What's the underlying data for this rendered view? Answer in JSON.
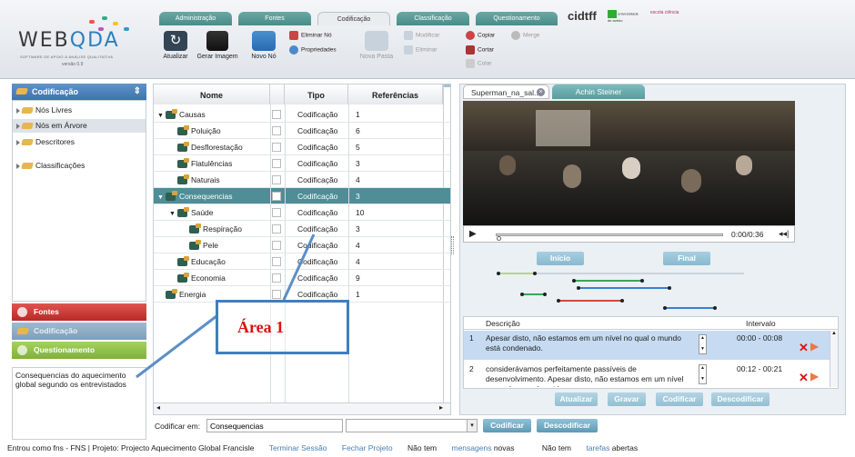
{
  "logo": {
    "wordmark_left": "WEB",
    "wordmark_right": "DA",
    "subtitle": "SOFTWARE DE APOIO À ANÁLISE QUALITATIVA",
    "version": "versão 0.9"
  },
  "top_tabs": [
    "Administração",
    "Fontes",
    "Codificação",
    "Classificação",
    "Questionamento"
  ],
  "partners": {
    "cidtff": "cidtff",
    "univ": "universidade de aveiro",
    "third": "escola ciência"
  },
  "toolbar": {
    "atualizar": "Atualizar",
    "gerar_imagem": "Gerar Imagem",
    "novo_no": "Novo Nó",
    "eliminar_no": "Eliminar Nó",
    "propriedades": "Propriedades",
    "modificar": "Modificar",
    "eliminar": "Eliminar",
    "nova_pasta": "Nova Pasta",
    "copiar": "Copiar",
    "merge": "Merge",
    "cortar": "Cortar",
    "colar": "Colar"
  },
  "left": {
    "header": "Codificação",
    "tree": [
      "Nós Livres",
      "Nós em Árvore",
      "Descritores",
      "Classificações"
    ],
    "accordions": [
      "Fontes",
      "Codificação",
      "Questionamento"
    ],
    "description": "Consequencias do aquecimento global segundo os entrevistados"
  },
  "table": {
    "headers": [
      "Nome",
      "Tipo",
      "Referências"
    ],
    "rows": [
      {
        "name": "Causas",
        "type": "Codificação",
        "refs": "1"
      },
      {
        "name": "Poluição",
        "type": "Codificação",
        "refs": "6"
      },
      {
        "name": "Desflorestação",
        "type": "Codificação",
        "refs": "5"
      },
      {
        "name": "Flatulências",
        "type": "Codificação",
        "refs": "3"
      },
      {
        "name": "Naturais",
        "type": "Codificação",
        "refs": "4"
      },
      {
        "name": "Consequencias",
        "type": "Codificação",
        "refs": "3"
      },
      {
        "name": "Saúde",
        "type": "Codificação",
        "refs": "10"
      },
      {
        "name": "Respiração",
        "type": "Codificação",
        "refs": "3"
      },
      {
        "name": "Pele",
        "type": "Codificação",
        "refs": "4"
      },
      {
        "name": "Educação",
        "type": "Codificação",
        "refs": "4"
      },
      {
        "name": "Economia",
        "type": "Codificação",
        "refs": "9"
      },
      {
        "name": "Energia",
        "type": "Codificação",
        "refs": "1"
      }
    ]
  },
  "annotation": {
    "label": "Área 1"
  },
  "coding": {
    "label": "Codificar em:",
    "value": "Consequencias",
    "codificar": "Codificar",
    "descodificar": "Descodificar"
  },
  "right": {
    "tab1": "Superman_na_sal...",
    "tab2": "Achin Steiner",
    "time": "0:00/0:36",
    "inicio": "Início",
    "final": "Final",
    "desc_header": "Descrição",
    "interval_header": "Intervalo",
    "rows": [
      {
        "n": "1",
        "text": "Apesar disto, não estamos em um nível no qual o mundo está condenado.",
        "interval": "00:00 - 00:08"
      },
      {
        "n": "2",
        "text": "considerávamos perfeitamente passíveis de desenvolvimento. Apesar disto, não estamos em um nível no qual o mundo está",
        "interval": "00:12 - 00:21"
      }
    ],
    "buttons": [
      "Atualizar",
      "Gravar",
      "Codificar",
      "Descodificar"
    ]
  },
  "status": {
    "login": "Entrou como fns - FNS | Projeto: Projecto Aquecimento Global Francisle",
    "terminar": "Terminar Sessão",
    "fechar": "Fechar Projeto",
    "msg_pre": "Não tem",
    "msg_link": "mensagens",
    "msg_post": "novas",
    "task_pre": "Não tem",
    "task_link": "tarefas",
    "task_post": "abertas"
  },
  "colors": {
    "accent": "#4f8d97",
    "header_blue": "#3d73ad",
    "fontes_red": "#c9302c",
    "quest_green": "#8dbf3f",
    "delete_red": "#d11"
  }
}
